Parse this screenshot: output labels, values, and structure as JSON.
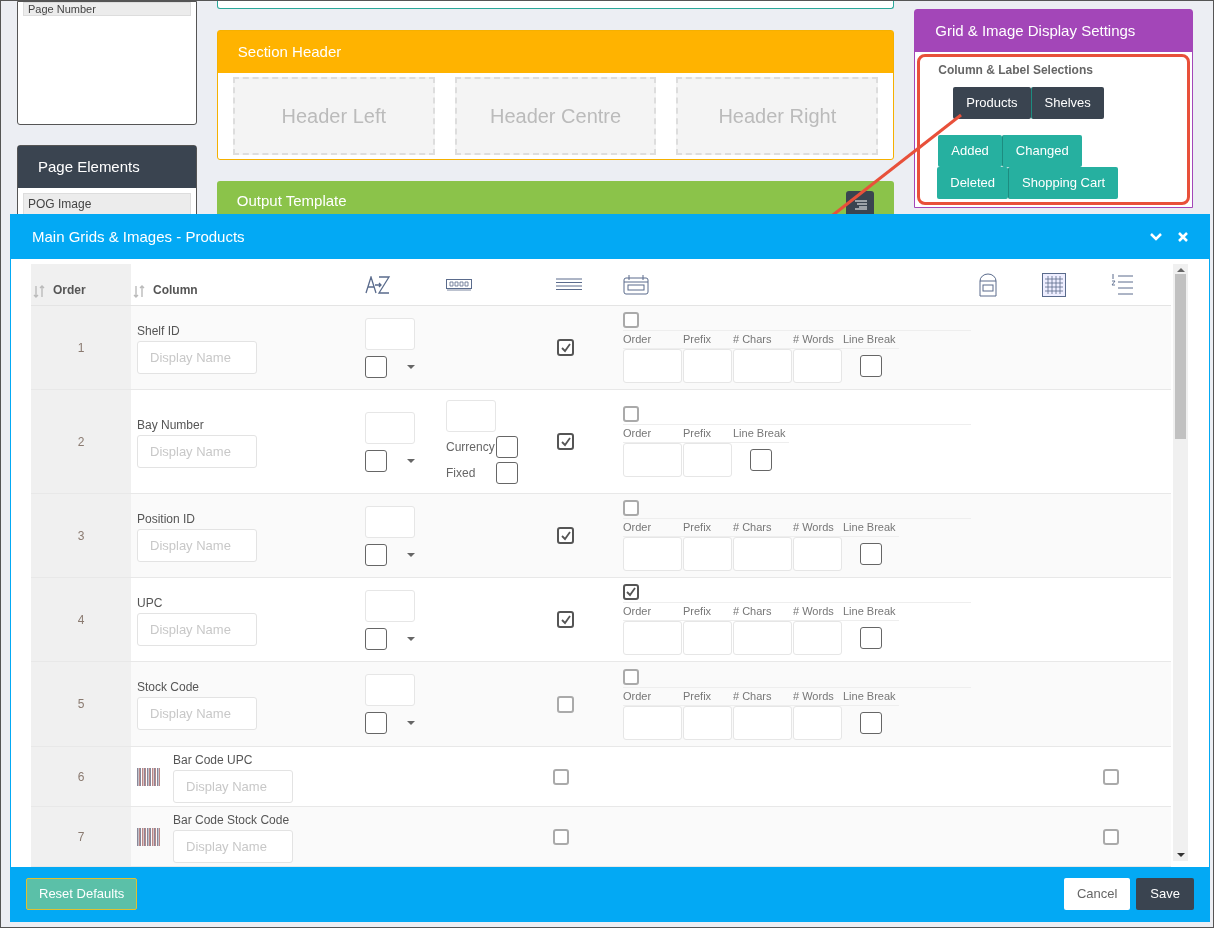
{
  "left_panel": {
    "items": [
      "Page Number"
    ]
  },
  "page_elements": {
    "title": "Page Elements",
    "items": [
      "POG Image"
    ]
  },
  "section_header": {
    "title": "Section Header",
    "slots": [
      "Header Left",
      "Header Centre",
      "Header Right"
    ]
  },
  "output_template": {
    "title": "Output Template"
  },
  "display_settings": {
    "title": "Grid & Image Display Settings",
    "section_title": "Column & Label Selections",
    "button_groups": [
      {
        "kind": "dark",
        "buttons": [
          "Products",
          "Shelves"
        ]
      },
      {
        "kind": "teal",
        "buttons": [
          "Added",
          "Changed"
        ]
      },
      {
        "kind": "teal",
        "buttons": [
          "Deleted",
          "Shopping Cart"
        ]
      }
    ]
  },
  "modal": {
    "title": "Main Grids & Images - Products",
    "columns": [
      {
        "label": "Order"
      },
      {
        "label": "Column"
      }
    ],
    "rows": [
      {
        "order": "1",
        "kind": "field",
        "label": "Shelf ID",
        "placeholder": "Display Name",
        "sort": {
          "checked": false
        },
        "shown": true,
        "format": {
          "checked": false,
          "fields": [
            {
              "label": "Order",
              "kind": "input"
            },
            {
              "label": "Prefix",
              "kind": "input"
            },
            {
              "label": "# Chars",
              "kind": "input"
            },
            {
              "label": "# Words",
              "kind": "input"
            },
            {
              "label": "Line Break",
              "kind": "checkbox",
              "checked": false
            }
          ]
        }
      },
      {
        "order": "2",
        "kind": "field",
        "label": "Bay Number",
        "placeholder": "Display Name",
        "sort": {
          "checked": false
        },
        "number": {
          "options": [
            {
              "label": "Currency",
              "checked": false
            },
            {
              "label": "Fixed",
              "checked": false
            }
          ]
        },
        "shown": true,
        "format": {
          "checked": false,
          "fields": [
            {
              "label": "Order",
              "kind": "input"
            },
            {
              "label": "Prefix",
              "kind": "input"
            },
            {
              "label": "Line Break",
              "kind": "checkbox",
              "checked": false
            }
          ]
        }
      },
      {
        "order": "3",
        "kind": "field",
        "label": "Position ID",
        "placeholder": "Display Name",
        "sort": {
          "checked": false
        },
        "shown": true,
        "format": {
          "checked": false,
          "fields": [
            {
              "label": "Order",
              "kind": "input"
            },
            {
              "label": "Prefix",
              "kind": "input"
            },
            {
              "label": "# Chars",
              "kind": "input"
            },
            {
              "label": "# Words",
              "kind": "input"
            },
            {
              "label": "Line Break",
              "kind": "checkbox",
              "checked": false
            }
          ]
        }
      },
      {
        "order": "4",
        "kind": "field",
        "label": "UPC",
        "placeholder": "Display Name",
        "sort": {
          "checked": false
        },
        "shown": true,
        "format": {
          "checked": true,
          "fields": [
            {
              "label": "Order",
              "kind": "input"
            },
            {
              "label": "Prefix",
              "kind": "input"
            },
            {
              "label": "# Chars",
              "kind": "input"
            },
            {
              "label": "# Words",
              "kind": "input"
            },
            {
              "label": "Line Break",
              "kind": "checkbox",
              "checked": false
            }
          ]
        }
      },
      {
        "order": "5",
        "kind": "field",
        "label": "Stock Code",
        "placeholder": "Display Name",
        "sort": {
          "checked": false
        },
        "shown": false,
        "format": {
          "checked": false,
          "fields": [
            {
              "label": "Order",
              "kind": "input"
            },
            {
              "label": "Prefix",
              "kind": "input"
            },
            {
              "label": "# Chars",
              "kind": "input"
            },
            {
              "label": "# Words",
              "kind": "input"
            },
            {
              "label": "Line Break",
              "kind": "checkbox",
              "checked": false
            }
          ]
        }
      },
      {
        "order": "6",
        "kind": "barcode",
        "label": "Bar Code UPC",
        "placeholder": "Display Name",
        "shown": false,
        "numbered": false
      },
      {
        "order": "7",
        "kind": "barcode",
        "label": "Bar Code Stock Code",
        "placeholder": "Display Name",
        "shown": false,
        "numbered": false
      }
    ],
    "footer": {
      "reset": "Reset Defaults",
      "cancel": "Cancel",
      "save": "Save"
    }
  }
}
